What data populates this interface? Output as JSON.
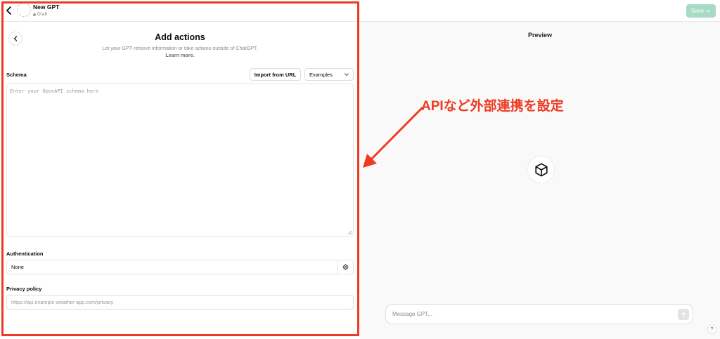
{
  "header": {
    "gpt_name": "New GPT",
    "gpt_status": "Draft",
    "save_label": "Save"
  },
  "editor": {
    "title": "Add actions",
    "subtitle": "Let your GPT retrieve information or take actions outside of ChatGPT.",
    "learn_more": "Learn more.",
    "schema_label": "Schema",
    "import_button": "Import from URL",
    "examples_select": "Examples",
    "schema_placeholder": "Enter your OpenAPI schema here",
    "auth_label": "Authentication",
    "auth_value": "None",
    "privacy_label": "Privacy policy",
    "privacy_placeholder": "https://api.example-weather-app.com/privacy"
  },
  "preview": {
    "title": "Preview",
    "message_placeholder": "Message GPT...",
    "help": "?"
  },
  "annotation": {
    "text": "APIなど外部連携を設定",
    "color": "#ee3a23"
  },
  "colors": {
    "accent_red": "#ee3a23",
    "save_button": "#a8dbc4",
    "preview_bg": "#f9f9f9"
  }
}
